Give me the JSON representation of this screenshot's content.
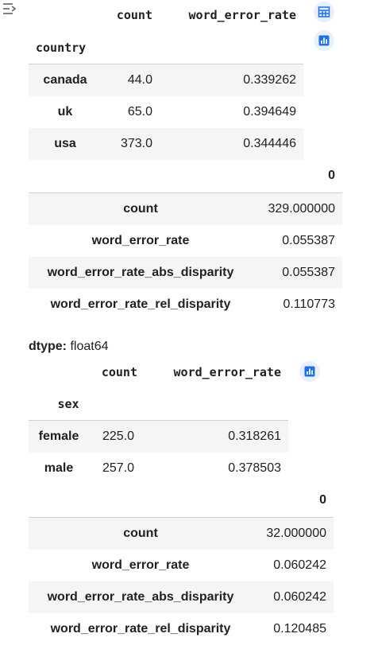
{
  "icons": {
    "gutter": "output-toggle-icon",
    "table": "table-view-icon",
    "chart": "chart-suggestion-icon",
    "accent": "#1a73e8"
  },
  "df_country": {
    "headers": [
      "count",
      "word_error_rate"
    ],
    "index_name": "country",
    "rows": [
      {
        "label": "canada",
        "count": "44.0",
        "wer": "0.339262"
      },
      {
        "label": "uk",
        "count": "65.0",
        "wer": "0.394649"
      },
      {
        "label": "usa",
        "count": "373.0",
        "wer": "0.344446"
      }
    ]
  },
  "series_country": {
    "column": "0",
    "rows": [
      {
        "label": "count",
        "value": "329.000000"
      },
      {
        "label": "word_error_rate",
        "value": "0.055387"
      },
      {
        "label": "word_error_rate_abs_disparity",
        "value": "0.055387"
      },
      {
        "label": "word_error_rate_rel_disparity",
        "value": "0.110773"
      }
    ],
    "dtype_label": "dtype:",
    "dtype_value": "float64"
  },
  "df_sex": {
    "headers": [
      "count",
      "word_error_rate"
    ],
    "index_name": "sex",
    "rows": [
      {
        "label": "female",
        "count": "225.0",
        "wer": "0.318261"
      },
      {
        "label": "male",
        "count": "257.0",
        "wer": "0.378503"
      }
    ]
  },
  "series_sex": {
    "column": "0",
    "rows": [
      {
        "label": "count",
        "value": "32.000000"
      },
      {
        "label": "word_error_rate",
        "value": "0.060242"
      },
      {
        "label": "word_error_rate_abs_disparity",
        "value": "0.060242"
      },
      {
        "label": "word_error_rate_rel_disparity",
        "value": "0.120485"
      }
    ]
  }
}
